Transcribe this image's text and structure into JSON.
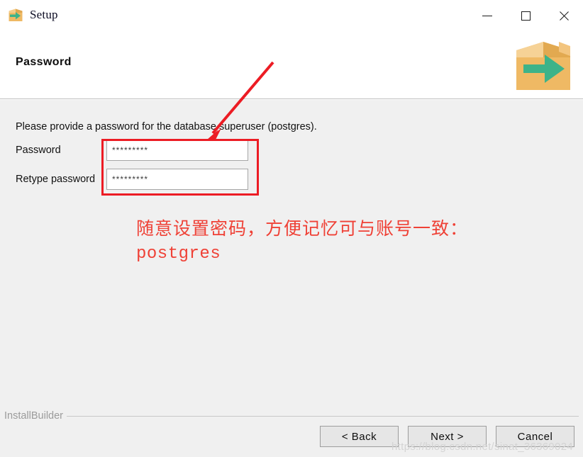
{
  "window": {
    "title": "Setup",
    "app_icon": "install-box-arrow-icon",
    "controls": {
      "minimize": "minimize-icon",
      "maximize": "maximize-icon",
      "close": "close-icon"
    }
  },
  "header": {
    "page_title": "Password",
    "brand_logo": "installbuilder-box-icon"
  },
  "main": {
    "instruction": "Please provide a password for the database superuser (postgres).",
    "fields": [
      {
        "label": "Password",
        "value": "*********",
        "masked": true,
        "name": "password-input"
      },
      {
        "label": "Retype password",
        "value": "*********",
        "masked": true,
        "name": "retype-password-input"
      }
    ]
  },
  "annotation": {
    "line1": "随意设置密码，方便记忆可与账号一致：",
    "line2": "postgres",
    "color": "#ef4136",
    "arrow": "red-arrow-pointing-to-password-field",
    "highlight_box": "red-rectangle-around-password-fields"
  },
  "footer": {
    "brand": "InstallBuilder",
    "buttons": [
      {
        "label": "< Back",
        "name": "back-button"
      },
      {
        "label": "Next >",
        "name": "next-button"
      },
      {
        "label": "Cancel",
        "name": "cancel-button"
      }
    ],
    "watermark": "https://blog.csdn.net/sinat_36369024"
  },
  "colors": {
    "accent_red": "#ec1c24",
    "body_bg": "#f0f0f0",
    "header_bg": "#ffffff",
    "box_orange": "#efb964",
    "arrow_green": "#3db389"
  }
}
